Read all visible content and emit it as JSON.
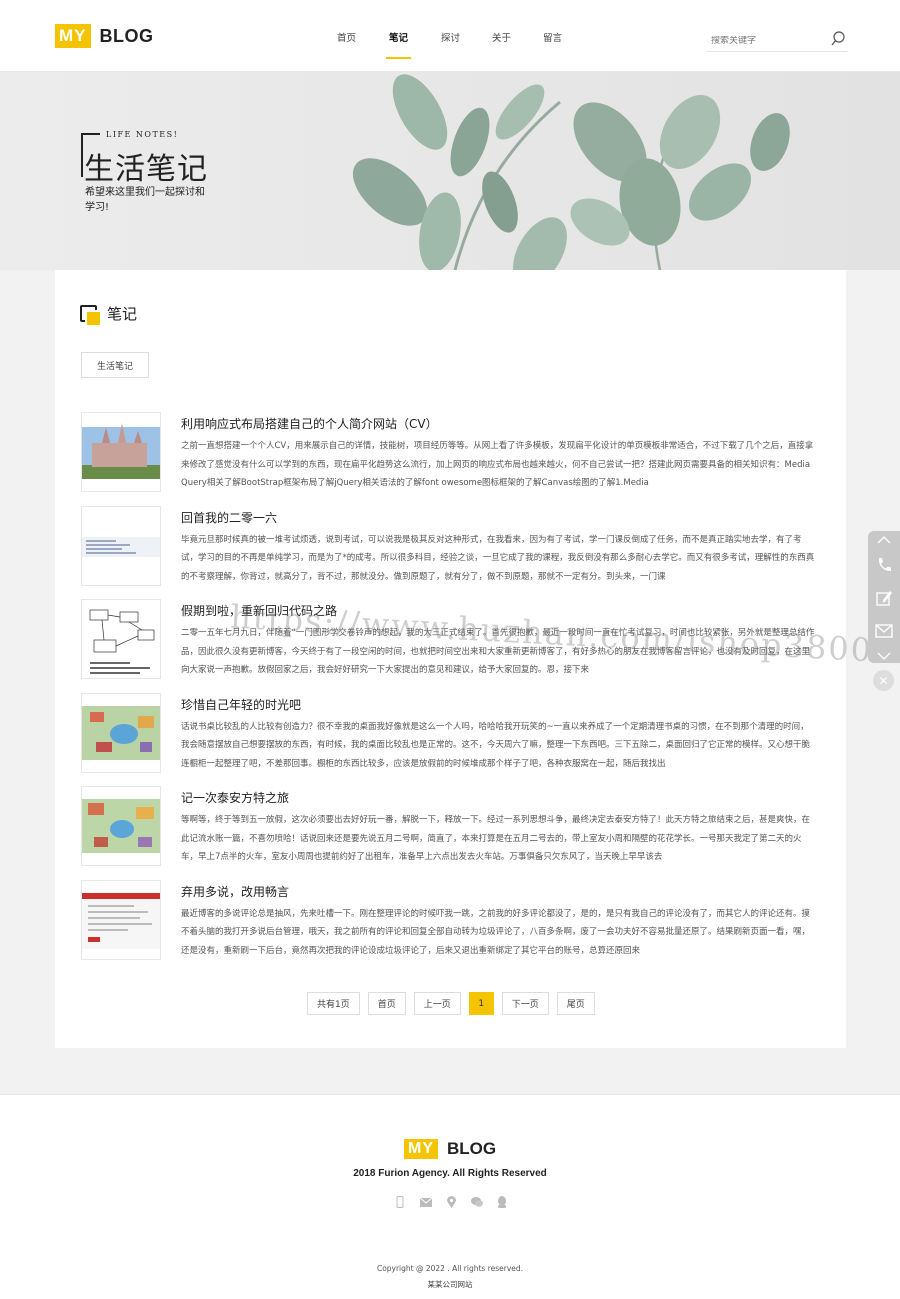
{
  "header": {
    "logo_my": "MY",
    "logo_blog": "BLOG",
    "nav": [
      "首页",
      "笔记",
      "探讨",
      "关于",
      "留言"
    ],
    "search_placeholder": "搜索关键字"
  },
  "banner": {
    "subtitle": "LIFE NOTES!",
    "title": "生活笔记",
    "desc": "希望来这里我们一起探讨和学习!"
  },
  "section": {
    "title": "笔记",
    "tag": "生活笔记"
  },
  "posts": [
    {
      "title": "利用响应式布局搭建自己的个人简介网站（CV）",
      "excerpt": "之前一直想搭建一个个人CV，用来展示自己的详情，技能树，项目经历等等。从网上看了许多模板，发现扁平化设计的单页模板非常适合，不过下载了几个之后，直接拿来修改了感觉没有什么可以学到的东西，现在扁平化趋势这么流行，加上网页的响应式布局也越来越火，何不自己尝试一把？搭建此网页需要具备的相关知识有：Media Query相关了解BootStrap框架布局了解jQuery相关语法的了解font owesome图标框架的了解Canvas绘图的了解1.Media"
    },
    {
      "title": "回首我的二零一六",
      "excerpt": "毕竟元旦那时候真的被一堆考试烦透，说到考试，可以说我是极其反对这种形式，在我看来，因为有了考试，学一门课反倒成了任务，而不是真正踏实地去学，有了考试，学习的目的不再是单纯学习，而是为了*的成考。所以很多科目，经验之谈，一旦它成了我的课程，我反倒没有那么多耐心去学它。而又有很多考试，理解性的东西真的不考察理解，你背过，就高分了，背不过，那就没分。做到原题了，就有分了，做不到原题，那就不一定有分。到头来，一门课"
    },
    {
      "title": "假期到啦，重新回归代码之路",
      "excerpt": "二零一五年七月九日，伴随着“一门图形学交卷铃声的想起，我的大三正式结束了。首先很抱歉，最近一段时间一直在忙考试复习，时间也比较紧张，另外就是整理总结作品，因此很久没有更新博客，今天终于有了一段空闲的时间，也就把时间空出来和大家重新更新博客了，有好多热心的朋友在我博客留言评论，也没有及时回复，在这里向大家说一声抱歉。放假回家之后，我会好好研究一下大家提出的意见和建议，给予大家回复的。恩，接下来"
    },
    {
      "title": "珍惜自己年轻的时光吧",
      "excerpt": "话说书桌比较乱的人比较有创造力？很不幸我的桌面我好像就是这么一个人吗，哈哈哈我开玩笑的~一直以来养成了一个定期清理书桌的习惯，在不到那个清理的时间，我会随意摆放自己想要摆放的东西，有时候，我的桌面比较乱也是正常的。这不，今天周六了嘛，整理一下东西吧。三下五除二，桌面回归了它正常的模样。又心想干脆连橱柜一起整理了吧，不差那回事。橱柜的东西比较多，应该是放假前的时候堆成那个样子了吧，各种衣服窝在一起，随后我找出"
    },
    {
      "title": "记一次泰安方特之旅",
      "excerpt": "等啊等，终于等到五一放假，这次必须要出去好好玩一番，解脱一下，释放一下。经过一系列思想斗争，最终决定去泰安方特了！此天方特之旅结束之后，甚是爽快，在此记流水账一篇，不喜勿喷哈！话说回来还是要先说五月二号啊，简直了，本来打算是在五月二号去的，带上室友小周和隔壁的花花学长。一号那天我定了第二天的火车，早上7点半的火车，室友小周周也提前约好了出租车，准备早上六点出发去火车站。万事俱备只欠东风了，当天晚上早早该去"
    },
    {
      "title": "弃用多说，改用畅言",
      "excerpt": "最近博客的多说评论总是抽风，先来吐槽一下。刚在整理评论的时候吓我一跳，之前我的好多评论都没了，是的，是只有我自己的评论没有了，而其它人的评论还有。摸不着头脑的我打开多说后台管理，哦天，我之前所有的评论和回复全部自动转为垃圾评论了，八百多条啊，废了一会功夫好不容易批量还原了。结果刷新页面一看，嘿，还是没有，重新刷一下后台，竟然再次把我的评论设成垃圾评论了，后来又退出重新绑定了其它平台的账号，总算还原回来"
    }
  ],
  "pager": {
    "total": "共有1页",
    "first": "首页",
    "prev": "上一页",
    "current": "1",
    "next": "下一页",
    "last": "尾页"
  },
  "footer": {
    "logo_my": "MY",
    "logo_blog": "BLOG",
    "rights": "2018 Furion Agency. All Rights Reserved",
    "copyright": "Copyright @ 2022 . All rights reserved.",
    "company": "某某公司网站"
  },
  "watermark": "https://www.huzhan.com/ishop38008",
  "colors": {
    "accent": "#f5c400"
  }
}
